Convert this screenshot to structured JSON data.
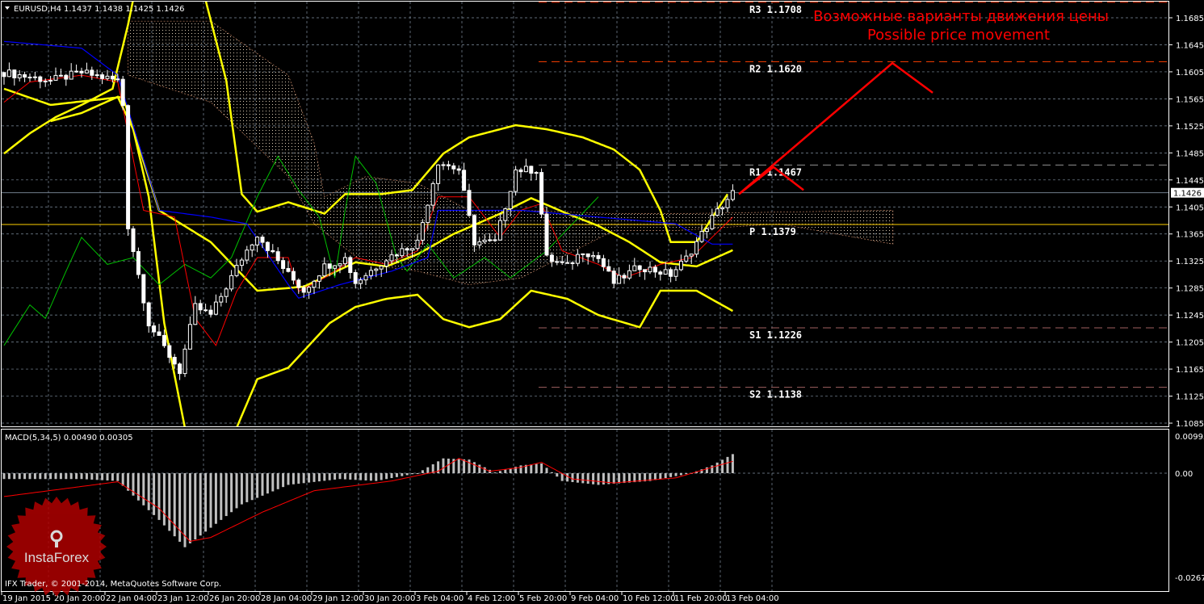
{
  "header": {
    "symbol": "EURUSD,H4",
    "ohlc": "1.1437 1.1438 1.1425 1.1426"
  },
  "macd_label": "MACD(5,34,5) 0.00490 0.00305",
  "copyright": "IFX Trader, © 2001-2014, MetaQuotes Software Corp.",
  "logo_text": "InstaForex",
  "annotation": {
    "line1": "Возможные варианты движения цены",
    "line2": "Possible price movement"
  },
  "colors": {
    "background": "#000000",
    "bollinger": "#ffff00",
    "tenkan": "#ff0000",
    "kijun": "#0000ff",
    "chikou": "#00c000",
    "forecast": "#ff0000",
    "grid": "#8090a0",
    "candle_up": "#ffffff",
    "candle_down": "#ffffff",
    "macd_hist": "#c0c0c0",
    "macd_signal": "#ff0000"
  },
  "chart_data": [
    {
      "type": "candlestick",
      "title": "EURUSD,H4",
      "ylim": [
        1.1068,
        1.1711
      ],
      "yticks": [
        "1.1685",
        "1.1645",
        "1.1605",
        "1.1565",
        "1.1525",
        "1.1485",
        "1.1445",
        "1.1405",
        "1.1365",
        "1.1325",
        "1.1285",
        "1.1245",
        "1.1205",
        "1.1165",
        "1.1125",
        "1.1085"
      ],
      "current_price": "1.1426",
      "xticks": [
        {
          "bar": 0,
          "label": "19 Jan 2015"
        },
        {
          "bar": 10,
          "label": "20 Jan 20:00"
        },
        {
          "bar": 20,
          "label": "22 Jan 04:00"
        },
        {
          "bar": 30,
          "label": "23 Jan 12:00"
        },
        {
          "bar": 40,
          "label": "26 Jan 20:00"
        },
        {
          "bar": 50,
          "label": "28 Jan 04:00"
        },
        {
          "bar": 60,
          "label": "29 Jan 12:00"
        },
        {
          "bar": 70,
          "label": "30 Jan 20:00"
        },
        {
          "bar": 80,
          "label": "3 Feb 04:00"
        },
        {
          "bar": 90,
          "label": "4 Feb 12:00"
        },
        {
          "bar": 100,
          "label": "5 Feb 20:00"
        },
        {
          "bar": 110,
          "label": "9 Feb 04:00"
        },
        {
          "bar": 120,
          "label": "10 Feb 12:00"
        },
        {
          "bar": 130,
          "label": "11 Feb 20:00"
        },
        {
          "bar": 140,
          "label": "13 Feb 04:00"
        }
      ],
      "close_path": [
        [
          0,
          1.1604
        ],
        [
          9,
          1.1592
        ],
        [
          15,
          1.1604
        ],
        [
          22,
          1.1592
        ],
        [
          23,
          1.1556
        ],
        [
          24,
          1.1377
        ],
        [
          28,
          1.1233
        ],
        [
          32,
          1.1185
        ],
        [
          34,
          1.1162
        ],
        [
          37,
          1.1257
        ],
        [
          40,
          1.1245
        ],
        [
          46,
          1.1329
        ],
        [
          49,
          1.1365
        ],
        [
          55,
          1.1305
        ],
        [
          58,
          1.1281
        ],
        [
          62,
          1.1317
        ],
        [
          66,
          1.1329
        ],
        [
          68,
          1.1293
        ],
        [
          74,
          1.1329
        ],
        [
          80,
          1.1353
        ],
        [
          84,
          1.1472
        ],
        [
          88,
          1.146
        ],
        [
          91,
          1.1353
        ],
        [
          95,
          1.1353
        ],
        [
          99,
          1.146
        ],
        [
          103,
          1.146
        ],
        [
          105,
          1.1329
        ],
        [
          109,
          1.1317
        ],
        [
          112,
          1.1341
        ],
        [
          115,
          1.1329
        ],
        [
          118,
          1.1293
        ],
        [
          123,
          1.1317
        ],
        [
          129,
          1.1305
        ],
        [
          132,
          1.1329
        ],
        [
          137,
          1.1389
        ],
        [
          141,
          1.1426
        ]
      ],
      "bollinger_upper": [
        [
          0,
          1.1484
        ],
        [
          5,
          1.1514
        ],
        [
          10,
          1.1538
        ],
        [
          15,
          1.1556
        ],
        [
          21,
          1.158
        ],
        [
          24,
          1.1675
        ],
        [
          26,
          1.175
        ],
        [
          36,
          1.178
        ],
        [
          39,
          1.1711
        ],
        [
          43,
          1.1592
        ],
        [
          46,
          1.1424
        ],
        [
          49,
          1.1398
        ],
        [
          55,
          1.1412
        ],
        [
          62,
          1.1395
        ],
        [
          66,
          1.1424
        ],
        [
          73,
          1.1424
        ],
        [
          79,
          1.143
        ],
        [
          85,
          1.1484
        ],
        [
          90,
          1.1508
        ],
        [
          99,
          1.1526
        ],
        [
          105,
          1.152
        ],
        [
          112,
          1.1508
        ],
        [
          118,
          1.149
        ],
        [
          123,
          1.146
        ],
        [
          127,
          1.14
        ],
        [
          129,
          1.1353
        ],
        [
          134,
          1.1353
        ],
        [
          137,
          1.1389
        ],
        [
          140,
          1.1424
        ]
      ],
      "bollinger_middle": [
        [
          0,
          1.158
        ],
        [
          9,
          1.1556
        ],
        [
          23,
          1.1568
        ],
        [
          30,
          1.14
        ],
        [
          40,
          1.1353
        ],
        [
          49,
          1.1281
        ],
        [
          58,
          1.1287
        ],
        [
          68,
          1.1323
        ],
        [
          74,
          1.1317
        ],
        [
          80,
          1.1335
        ],
        [
          87,
          1.1365
        ],
        [
          96,
          1.1395
        ],
        [
          102,
          1.1418
        ],
        [
          109,
          1.1395
        ],
        [
          115,
          1.1377
        ],
        [
          121,
          1.1353
        ],
        [
          127,
          1.1323
        ],
        [
          134,
          1.1317
        ],
        [
          141,
          1.1341
        ]
      ],
      "bollinger_lower": [
        [
          9,
          1.1532
        ],
        [
          15,
          1.1544
        ],
        [
          22,
          1.1568
        ],
        [
          25,
          1.152
        ],
        [
          28,
          1.142
        ],
        [
          31,
          1.1233
        ],
        [
          35,
          1.1078
        ],
        [
          38,
          1.099
        ],
        [
          44,
          1.099
        ],
        [
          45,
          1.1078
        ],
        [
          49,
          1.115
        ],
        [
          55,
          1.1167
        ],
        [
          63,
          1.1233
        ],
        [
          68,
          1.1257
        ],
        [
          74,
          1.1269
        ],
        [
          80,
          1.1275
        ],
        [
          85,
          1.1239
        ],
        [
          90,
          1.1227
        ],
        [
          96,
          1.1239
        ],
        [
          102,
          1.1281
        ],
        [
          109,
          1.1269
        ],
        [
          115,
          1.1245
        ],
        [
          123,
          1.1227
        ],
        [
          127,
          1.1281
        ],
        [
          134,
          1.1281
        ],
        [
          141,
          1.1251
        ]
      ],
      "tenkan": [
        [
          0,
          1.156
        ],
        [
          5,
          1.159
        ],
        [
          15,
          1.16
        ],
        [
          22,
          1.159
        ],
        [
          27,
          1.14
        ],
        [
          33,
          1.139
        ],
        [
          37,
          1.124
        ],
        [
          41,
          1.12
        ],
        [
          45,
          1.128
        ],
        [
          49,
          1.133
        ],
        [
          55,
          1.133
        ],
        [
          57,
          1.128
        ],
        [
          62,
          1.13
        ],
        [
          68,
          1.133
        ],
        [
          74,
          1.132
        ],
        [
          80,
          1.134
        ],
        [
          84,
          1.142
        ],
        [
          90,
          1.142
        ],
        [
          96,
          1.136
        ],
        [
          100,
          1.14
        ],
        [
          104,
          1.141
        ],
        [
          108,
          1.134
        ],
        [
          115,
          1.132
        ],
        [
          120,
          1.13
        ],
        [
          127,
          1.132
        ],
        [
          133,
          1.133
        ],
        [
          137,
          1.136
        ],
        [
          141,
          1.139
        ]
      ],
      "kijun": [
        [
          0,
          1.165
        ],
        [
          15,
          1.164
        ],
        [
          22,
          1.16
        ],
        [
          26,
          1.15
        ],
        [
          30,
          1.14
        ],
        [
          40,
          1.139
        ],
        [
          47,
          1.138
        ],
        [
          55,
          1.129
        ],
        [
          57,
          1.127
        ],
        [
          65,
          1.129
        ],
        [
          75,
          1.131
        ],
        [
          82,
          1.133
        ],
        [
          84,
          1.14
        ],
        [
          100,
          1.14
        ],
        [
          115,
          1.139
        ],
        [
          130,
          1.138
        ],
        [
          137,
          1.135
        ],
        [
          141,
          1.135
        ]
      ],
      "chikou": [
        [
          0,
          1.12
        ],
        [
          5,
          1.126
        ],
        [
          8,
          1.124
        ],
        [
          12,
          1.131
        ],
        [
          15,
          1.136
        ],
        [
          20,
          1.132
        ],
        [
          25,
          1.133
        ],
        [
          30,
          1.129
        ],
        [
          35,
          1.132
        ],
        [
          40,
          1.13
        ],
        [
          44,
          1.133
        ],
        [
          49,
          1.142
        ],
        [
          53,
          1.148
        ],
        [
          57,
          1.143
        ],
        [
          61,
          1.139
        ],
        [
          64,
          1.13
        ],
        [
          66,
          1.14
        ],
        [
          68,
          1.148
        ],
        [
          72,
          1.144
        ],
        [
          76,
          1.133
        ],
        [
          78,
          1.131
        ],
        [
          82,
          1.135
        ],
        [
          87,
          1.13
        ],
        [
          93,
          1.133
        ],
        [
          98,
          1.13
        ],
        [
          105,
          1.134
        ],
        [
          115,
          1.142
        ]
      ],
      "cloud_upper": [
        [
          24,
          1.168
        ],
        [
          40,
          1.168
        ],
        [
          55,
          1.16
        ],
        [
          60,
          1.15
        ],
        [
          62,
          1.142
        ],
        [
          70,
          1.145
        ],
        [
          80,
          1.144
        ],
        [
          90,
          1.14
        ],
        [
          100,
          1.14
        ],
        [
          118,
          1.1395
        ],
        [
          130,
          1.1395
        ],
        [
          172,
          1.14
        ]
      ],
      "cloud_lower": [
        [
          24,
          1.16
        ],
        [
          40,
          1.156
        ],
        [
          55,
          1.145
        ],
        [
          60,
          1.138
        ],
        [
          70,
          1.132
        ],
        [
          80,
          1.131
        ],
        [
          90,
          1.129
        ],
        [
          100,
          1.13
        ],
        [
          118,
          1.137
        ],
        [
          130,
          1.137
        ],
        [
          150,
          1.138
        ],
        [
          172,
          1.135
        ]
      ],
      "pivots": [
        {
          "label": "R3",
          "value": "1.1708",
          "color": "#ff4000"
        },
        {
          "label": "R2",
          "value": "1.1620",
          "color": "#ff4000"
        },
        {
          "label": "R1",
          "value": "1.1467",
          "color": "#909090"
        },
        {
          "label": "P",
          "value": "1.1379",
          "color": "#ffd000"
        },
        {
          "label": "S1",
          "value": "1.1226",
          "color": "#a06060"
        },
        {
          "label": "S2",
          "value": "1.1138",
          "color": "#a06060"
        }
      ],
      "forecast_paths": [
        [
          [
            142.2,
            1.1424
          ],
          [
            148.9,
            1.1464
          ],
          [
            154.7,
            1.143
          ]
        ],
        [
          [
            142.2,
            1.1424
          ],
          [
            171.9,
            1.1618
          ],
          [
            179.7,
            1.1574
          ]
        ]
      ]
    },
    {
      "type": "bar",
      "title": "MACD(5,34,5)",
      "ylim": [
        -0.02677,
        0.00995
      ],
      "yticks": [
        "0.00995",
        "0.00",
        "-0.02677"
      ],
      "histogram_path": [
        [
          0,
          -0.0015
        ],
        [
          15,
          -0.0015
        ],
        [
          22,
          -0.002
        ],
        [
          30,
          -0.012
        ],
        [
          35,
          -0.019
        ],
        [
          40,
          -0.014
        ],
        [
          46,
          -0.008
        ],
        [
          55,
          -0.003
        ],
        [
          65,
          -0.0015
        ],
        [
          72,
          -0.002
        ],
        [
          80,
          0
        ],
        [
          85,
          0.0038
        ],
        [
          90,
          0.0035
        ],
        [
          95,
          0.0002
        ],
        [
          100,
          0.002
        ],
        [
          104,
          0.0025
        ],
        [
          108,
          -0.002
        ],
        [
          115,
          -0.003
        ],
        [
          125,
          -0.002
        ],
        [
          133,
          0
        ],
        [
          137,
          0.002
        ],
        [
          141,
          0.0049
        ]
      ],
      "signal_path": [
        [
          0,
          -0.006
        ],
        [
          22,
          -0.0022
        ],
        [
          30,
          -0.009
        ],
        [
          36,
          -0.0175
        ],
        [
          40,
          -0.0165
        ],
        [
          50,
          -0.01
        ],
        [
          60,
          -0.0045
        ],
        [
          75,
          -0.002
        ],
        [
          84,
          0.0005
        ],
        [
          88,
          0.0038
        ],
        [
          94,
          0.0005
        ],
        [
          100,
          0.0015
        ],
        [
          104,
          0.0028
        ],
        [
          110,
          -0.0015
        ],
        [
          118,
          -0.0025
        ],
        [
          130,
          -0.0012
        ],
        [
          141,
          0.00305
        ]
      ]
    }
  ]
}
